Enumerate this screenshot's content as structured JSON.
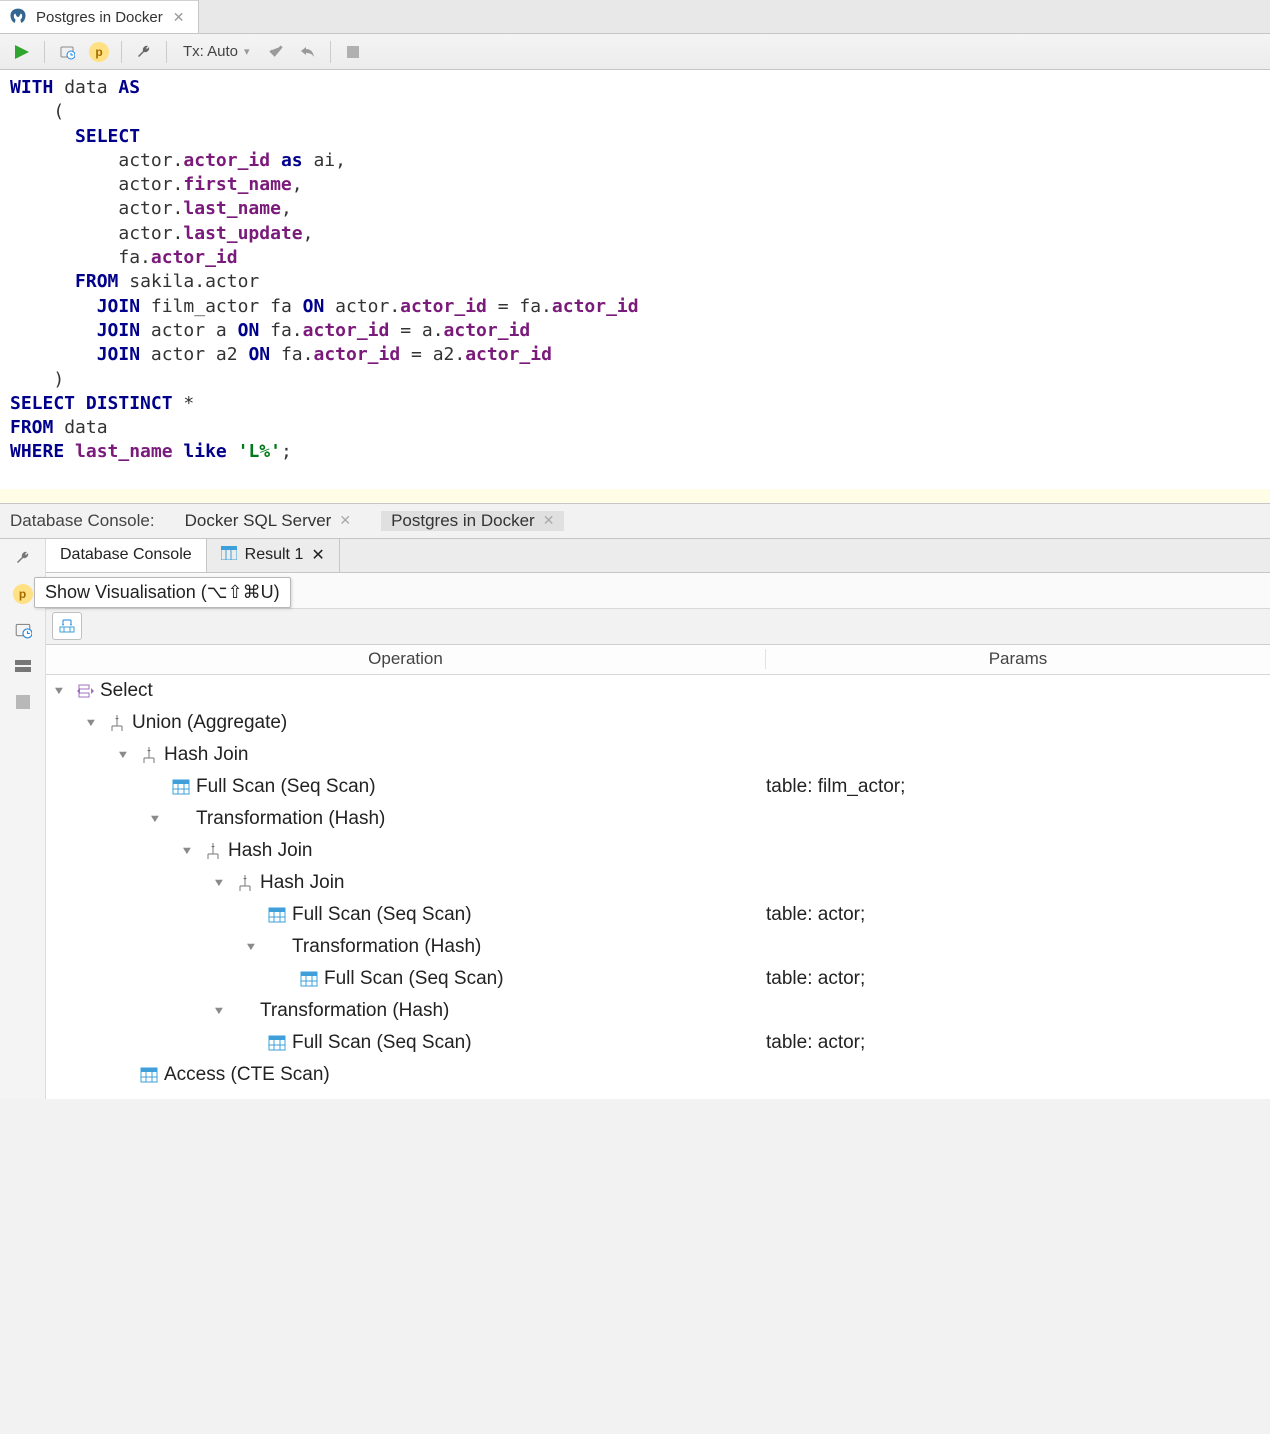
{
  "editor_tab": {
    "title": "Postgres in Docker"
  },
  "toolbar": {
    "tx_label": "Tx: Auto"
  },
  "sql": {
    "tokens": [
      {
        "t": "WITH",
        "c": "kw"
      },
      {
        "t": " data ",
        "c": ""
      },
      {
        "t": "AS",
        "c": "kw"
      },
      {
        "t": "\n",
        "c": ""
      },
      {
        "t": "    (",
        "c": ""
      },
      {
        "t": "\n",
        "c": ""
      },
      {
        "t": "      ",
        "c": ""
      },
      {
        "t": "SELECT",
        "c": "kw"
      },
      {
        "t": "\n",
        "c": ""
      },
      {
        "t": "          actor.",
        "c": ""
      },
      {
        "t": "actor_id",
        "c": "col"
      },
      {
        "t": " ",
        "c": ""
      },
      {
        "t": "as",
        "c": "kw"
      },
      {
        "t": " ai,",
        "c": ""
      },
      {
        "t": "\n",
        "c": ""
      },
      {
        "t": "          actor.",
        "c": ""
      },
      {
        "t": "first_name",
        "c": "col"
      },
      {
        "t": ",",
        "c": ""
      },
      {
        "t": "\n",
        "c": ""
      },
      {
        "t": "          actor.",
        "c": ""
      },
      {
        "t": "last_name",
        "c": "col"
      },
      {
        "t": ",",
        "c": ""
      },
      {
        "t": "\n",
        "c": ""
      },
      {
        "t": "          actor.",
        "c": ""
      },
      {
        "t": "last_update",
        "c": "col"
      },
      {
        "t": ",",
        "c": ""
      },
      {
        "t": "\n",
        "c": ""
      },
      {
        "t": "          fa.",
        "c": ""
      },
      {
        "t": "actor_id",
        "c": "col"
      },
      {
        "t": "\n",
        "c": ""
      },
      {
        "t": "      ",
        "c": ""
      },
      {
        "t": "FROM",
        "c": "kw"
      },
      {
        "t": " sakila.actor",
        "c": ""
      },
      {
        "t": "\n",
        "c": ""
      },
      {
        "t": "        ",
        "c": ""
      },
      {
        "t": "JOIN",
        "c": "kw"
      },
      {
        "t": " film_actor fa ",
        "c": ""
      },
      {
        "t": "ON",
        "c": "kw"
      },
      {
        "t": " actor.",
        "c": ""
      },
      {
        "t": "actor_id",
        "c": "col"
      },
      {
        "t": " = fa.",
        "c": ""
      },
      {
        "t": "actor_id",
        "c": "col"
      },
      {
        "t": "\n",
        "c": ""
      },
      {
        "t": "        ",
        "c": ""
      },
      {
        "t": "JOIN",
        "c": "kw"
      },
      {
        "t": " actor a ",
        "c": ""
      },
      {
        "t": "ON",
        "c": "kw"
      },
      {
        "t": " fa.",
        "c": ""
      },
      {
        "t": "actor_id",
        "c": "col"
      },
      {
        "t": " = a.",
        "c": ""
      },
      {
        "t": "actor_id",
        "c": "col"
      },
      {
        "t": "\n",
        "c": ""
      },
      {
        "t": "        ",
        "c": ""
      },
      {
        "t": "JOIN",
        "c": "kw"
      },
      {
        "t": " actor a2 ",
        "c": ""
      },
      {
        "t": "ON",
        "c": "kw"
      },
      {
        "t": " fa.",
        "c": ""
      },
      {
        "t": "actor_id",
        "c": "col"
      },
      {
        "t": " = a2.",
        "c": ""
      },
      {
        "t": "actor_id",
        "c": "col"
      },
      {
        "t": "\n",
        "c": ""
      },
      {
        "t": "    )",
        "c": ""
      },
      {
        "t": "\n",
        "c": ""
      },
      {
        "t": "SELECT DISTINCT",
        "c": "kw"
      },
      {
        "t": " *",
        "c": ""
      },
      {
        "t": "\n",
        "c": ""
      },
      {
        "t": "FROM",
        "c": "kw"
      },
      {
        "t": " data",
        "c": ""
      },
      {
        "t": "\n",
        "c": ""
      },
      {
        "t": "WHERE",
        "c": "kw"
      },
      {
        "t": " ",
        "c": ""
      },
      {
        "t": "last_name",
        "c": "col"
      },
      {
        "t": " ",
        "c": ""
      },
      {
        "t": "like",
        "c": "kw"
      },
      {
        "t": " ",
        "c": ""
      },
      {
        "t": "'L%'",
        "c": "str"
      },
      {
        "t": ";",
        "c": ""
      }
    ]
  },
  "dbc": {
    "label": "Database Console:",
    "tab1": "Docker SQL Server",
    "tab2": "Postgres in Docker"
  },
  "result_tabs": {
    "tab1": "Database Console",
    "tab2": "Result 1"
  },
  "tooltip": "Show Visualisation (⌥⇧⌘U)",
  "plan": {
    "head_op": "Operation",
    "head_params": "Params",
    "rows": [
      {
        "indent": 0,
        "expander": true,
        "icon": "select",
        "label": "Select",
        "params": ""
      },
      {
        "indent": 1,
        "expander": true,
        "icon": "join",
        "label": "Union (Aggregate)",
        "params": ""
      },
      {
        "indent": 2,
        "expander": true,
        "icon": "join",
        "label": "Hash Join",
        "params": ""
      },
      {
        "indent": 3,
        "expander": false,
        "icon": "scan",
        "label": "Full Scan (Seq Scan)",
        "params": "table: film_actor;"
      },
      {
        "indent": 3,
        "expander": true,
        "icon": "",
        "label": "Transformation (Hash)",
        "params": ""
      },
      {
        "indent": 4,
        "expander": true,
        "icon": "join",
        "label": "Hash Join",
        "params": ""
      },
      {
        "indent": 5,
        "expander": true,
        "icon": "join",
        "label": "Hash Join",
        "params": ""
      },
      {
        "indent": 6,
        "expander": false,
        "icon": "scan",
        "label": "Full Scan (Seq Scan)",
        "params": "table: actor;"
      },
      {
        "indent": 6,
        "expander": true,
        "icon": "",
        "label": "Transformation (Hash)",
        "params": ""
      },
      {
        "indent": 7,
        "expander": false,
        "icon": "scan",
        "label": "Full Scan (Seq Scan)",
        "params": "table: actor;"
      },
      {
        "indent": 5,
        "expander": true,
        "icon": "",
        "label": "Transformation (Hash)",
        "params": ""
      },
      {
        "indent": 6,
        "expander": false,
        "icon": "scan",
        "label": "Full Scan (Seq Scan)",
        "params": "table: actor;"
      },
      {
        "indent": 2,
        "expander": false,
        "icon": "scan",
        "label": "Access (CTE Scan)",
        "params": ""
      }
    ]
  }
}
